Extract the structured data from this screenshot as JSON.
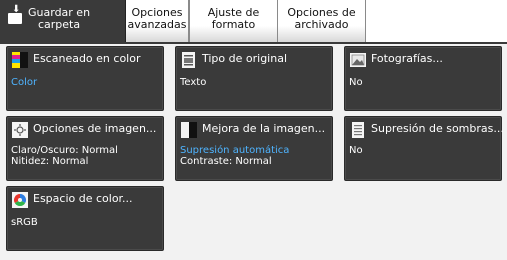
{
  "tabs": [
    {
      "label": "Guardar en\ncarpeta",
      "active": true
    },
    {
      "label": "Opciones\navanzadas",
      "active": false
    },
    {
      "label": "Ajuste de\nformato",
      "active": false
    },
    {
      "label": "Opciones de\narchivado",
      "active": false
    }
  ],
  "tiles": {
    "color_scan": {
      "title": "Escaneado en color",
      "value": "Color"
    },
    "original_type": {
      "title": "Tipo de original",
      "value": "Texto"
    },
    "photos": {
      "title": "Fotografías...",
      "value": "No"
    },
    "image_options": {
      "title": "Opciones de imagen...",
      "value1": "Claro/Oscuro: Normal",
      "value2": "Nitidez: Normal"
    },
    "image_enhancement": {
      "title": "Mejora de la imagen...",
      "value1": "Supresión automática",
      "value2": "Contraste: Normal"
    },
    "shadow_suppression": {
      "title": "Supresión de sombras...",
      "value": "No"
    },
    "color_space": {
      "title": "Espacio de color...",
      "value": "sRGB"
    }
  },
  "colors": {
    "tile_bg": "#3a3a3a",
    "accent_blue": "#4fb4ff",
    "active_tab_bg": "#3a3a3a"
  }
}
